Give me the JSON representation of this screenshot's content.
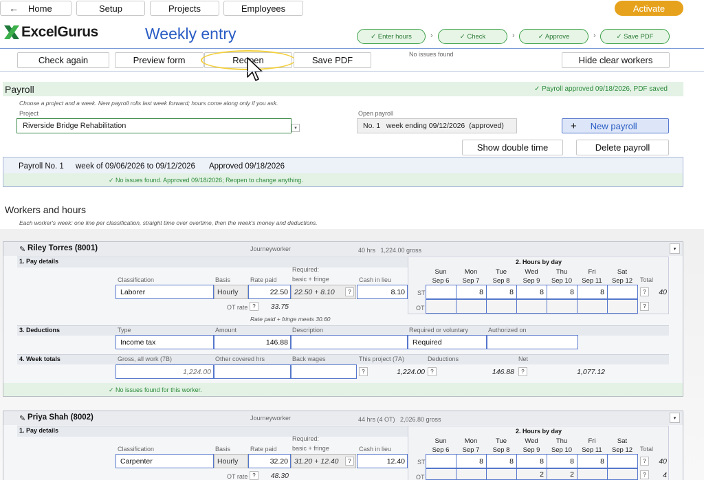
{
  "nav": {
    "home": "Home",
    "setup": "Setup",
    "projects": "Projects",
    "employees": "Employees",
    "activate": "Activate"
  },
  "brand": {
    "logo_text": "ExcelGurus",
    "page_title": "Weekly entry"
  },
  "steps": [
    "✓ Enter hours",
    "✓ Check",
    "✓ Approve",
    "✓ Save PDF"
  ],
  "toolbar": {
    "check_again": "Check again",
    "preview_form": "Preview form",
    "reopen": "Reopen",
    "save_pdf": "Save PDF",
    "status": "No issues found",
    "hide_clear": "Hide clear workers"
  },
  "payroll": {
    "title": "Payroll",
    "approved_msg": "✓ Payroll approved 09/18/2026, PDF saved",
    "hint": "Choose a project and a week. New payroll rolls last week forward; hours come along only if you ask.",
    "project_label": "Project",
    "project_value": "Riverside Bridge Rehabilitation",
    "open_label": "Open payroll",
    "open_value": "No. 1   week ending 09/12/2026  (approved)",
    "new_payroll": "New payroll",
    "new_plus": "+",
    "show_double": "Show double time",
    "delete": "Delete payroll"
  },
  "summary": {
    "no": "Payroll No. 1",
    "week": "week of 09/06/2026 to 09/12/2026",
    "approved": "Approved 09/18/2026",
    "msg": "✓  No issues found. Approved 09/18/2026; Reopen to change anything."
  },
  "workers_section": {
    "title": "Workers and hours",
    "hint": "Each worker's week: one line per classification, straight time over overtime, then the week's money and deductions."
  },
  "labels": {
    "pay_details": "1. Pay details",
    "hours_by_day": "2. Hours by day",
    "deductions": "3. Deductions",
    "week_totals": "4. Week totals",
    "classification": "Classification",
    "basis": "Basis",
    "rate_paid": "Rate paid",
    "required_1": "Required:",
    "required_2": "basic + fringe",
    "cash_in_lieu": "Cash in lieu",
    "total": "Total",
    "st": "ST",
    "ot": "OT",
    "ot_rate": "OT rate",
    "type": "Type",
    "amount": "Amount",
    "description": "Description",
    "req_vol": "Required or voluntary",
    "authorized": "Authorized on",
    "gross_all": "Gross, all work (7B)",
    "other_hrs": "Other covered hrs",
    "back_wages": "Back wages",
    "this_project": "This project (7A)",
    "ded_total": "Deductions",
    "net": "Net",
    "q": "?",
    "collapse": "▾"
  },
  "days": [
    {
      "d": "Sun",
      "date": "Sep 6"
    },
    {
      "d": "Mon",
      "date": "Sep 7"
    },
    {
      "d": "Tue",
      "date": "Sep 8"
    },
    {
      "d": "Wed",
      "date": "Sep 9"
    },
    {
      "d": "Thu",
      "date": "Sep 10"
    },
    {
      "d": "Fri",
      "date": "Sep 11"
    },
    {
      "d": "Sat",
      "date": "Sep 12"
    }
  ],
  "worker1": {
    "name": "Riley Torres (8001)",
    "role": "Journeyworker",
    "hours": "40 hrs   1,224.00 gross",
    "classification": "Laborer",
    "basis": "Hourly",
    "rate": "22.50",
    "required": "22.50 + 8.10",
    "cash": "8.10",
    "ot_rate": "33.75",
    "meets": "Rate paid + fringe meets 30.60",
    "st": [
      "",
      "8",
      "8",
      "8",
      "8",
      "8",
      ""
    ],
    "ot": [
      "",
      "",
      "",
      "",
      "",
      "",
      ""
    ],
    "st_total": "40",
    "ot_total": "",
    "ded_type": "Income tax",
    "ded_amount": "146.88",
    "ded_desc": "",
    "ded_req": "Required",
    "ded_auth": "",
    "gross": "1,224.00",
    "other_hrs": "",
    "back_wages": "",
    "this_project": "1,224.00",
    "deductions": "146.88",
    "net": "1,077.12",
    "msg": "✓  No issues found for this worker."
  },
  "worker2": {
    "name": "Priya Shah (8002)",
    "role": "Journeyworker",
    "hours": "44 hrs (4 OT)   2,026.80 gross",
    "classification": "Carpenter",
    "basis": "Hourly",
    "rate": "32.20",
    "required": "31.20 + 12.40",
    "cash": "12.40",
    "ot_rate": "48.30",
    "st": [
      "",
      "8",
      "8",
      "8",
      "8",
      "8",
      ""
    ],
    "ot": [
      "",
      "",
      "",
      "2",
      "2",
      "",
      ""
    ],
    "st_total": "40",
    "ot_total": "4"
  },
  "colors": {
    "accent": "#e6a21c",
    "blue": "#2a5cc4",
    "green": "#2d8a3a"
  }
}
